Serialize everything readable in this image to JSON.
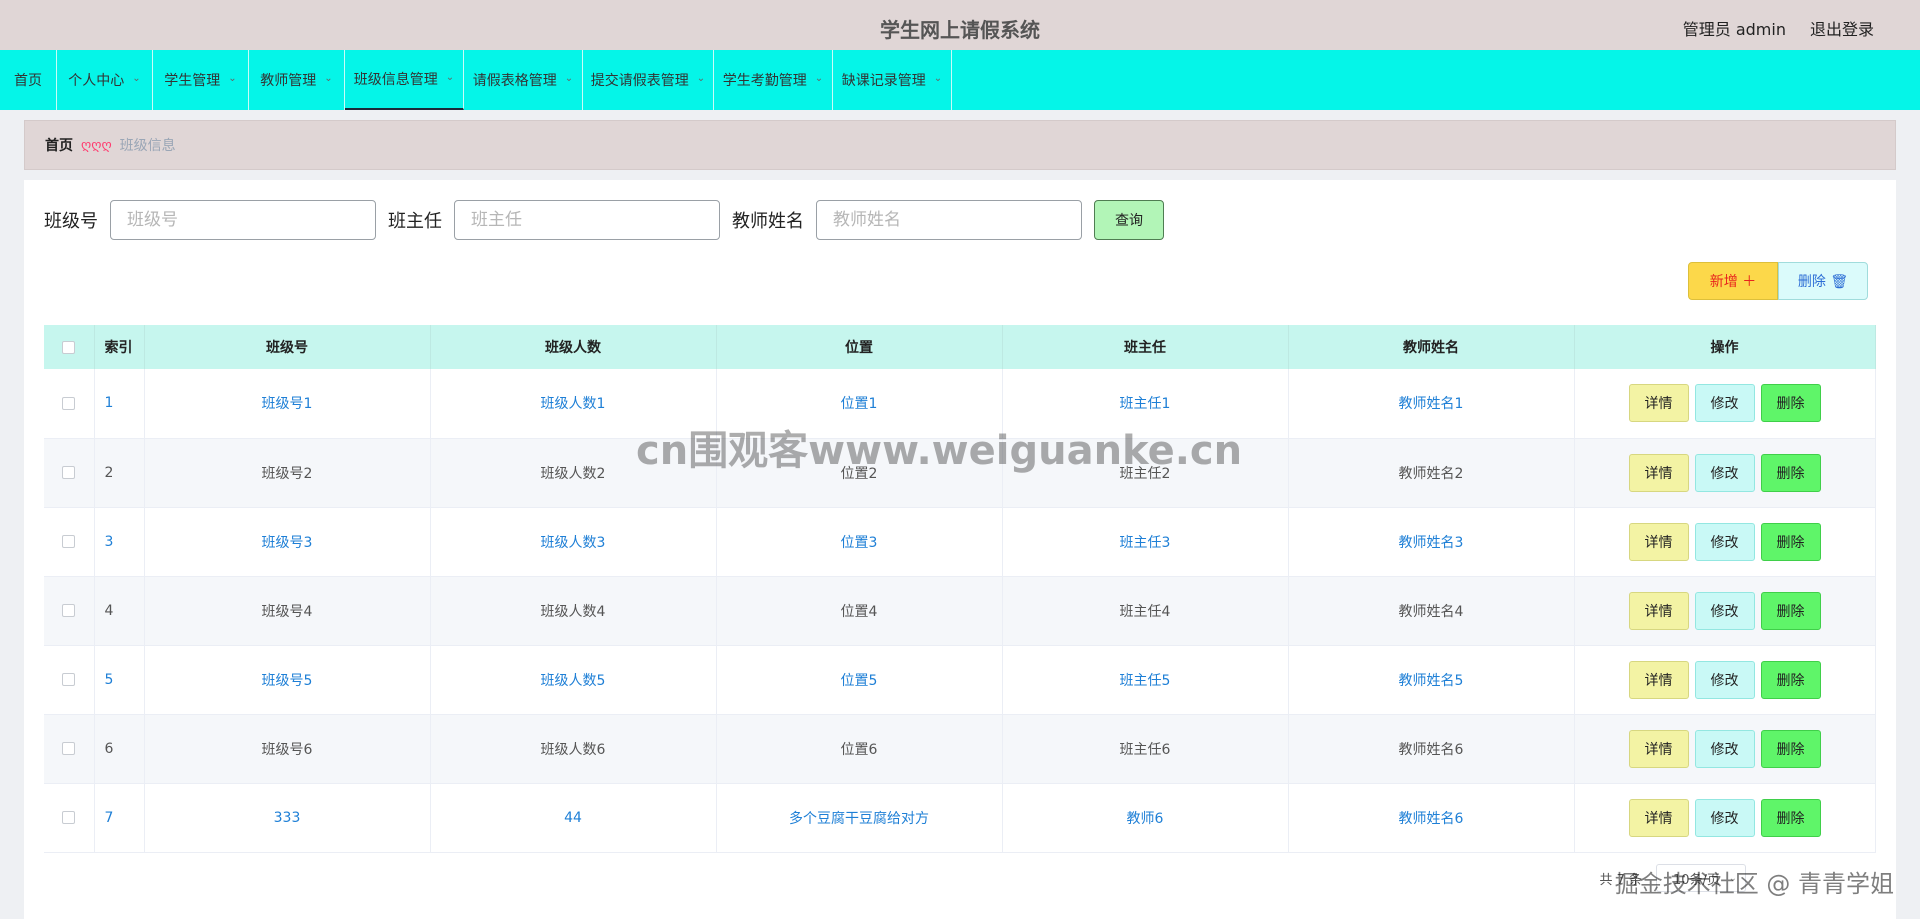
{
  "header": {
    "title": "学生网上请假系统",
    "user_label": "管理员 admin",
    "logout_label": "退出登录"
  },
  "nav": {
    "items": [
      {
        "label": "首页",
        "dropdown": false,
        "active": false
      },
      {
        "label": "个人中心",
        "dropdown": true,
        "active": false
      },
      {
        "label": "学生管理",
        "dropdown": true,
        "active": false
      },
      {
        "label": "教师管理",
        "dropdown": true,
        "active": false
      },
      {
        "label": "班级信息管理",
        "dropdown": true,
        "active": true
      },
      {
        "label": "请假表格管理",
        "dropdown": true,
        "active": false
      },
      {
        "label": "提交请假表管理",
        "dropdown": true,
        "active": false
      },
      {
        "label": "学生考勤管理",
        "dropdown": true,
        "active": false
      },
      {
        "label": "缺课记录管理",
        "dropdown": true,
        "active": false
      }
    ]
  },
  "breadcrumb": {
    "home": "首页",
    "separator": "ღღღ",
    "current": "班级信息"
  },
  "search": {
    "class_no_label": "班级号",
    "class_no_placeholder": "班级号",
    "head_teacher_label": "班主任",
    "head_teacher_placeholder": "班主任",
    "teacher_name_label": "教师姓名",
    "teacher_name_placeholder": "教师姓名",
    "query_label": "查询"
  },
  "actions": {
    "add_label": "新增 ＋",
    "delete_label": "删除 🗑"
  },
  "table": {
    "headers": {
      "index": "索引",
      "class_no": "班级号",
      "class_size": "班级人数",
      "location": "位置",
      "head_teacher": "班主任",
      "teacher_name": "教师姓名",
      "operation": "操作"
    },
    "buttons": {
      "detail": "详情",
      "edit": "修改",
      "delete": "删除"
    },
    "rows": [
      {
        "index": "1",
        "class_no": "班级号1",
        "class_size": "班级人数1",
        "location": "位置1",
        "head_teacher": "班主任1",
        "teacher_name": "教师姓名1"
      },
      {
        "index": "2",
        "class_no": "班级号2",
        "class_size": "班级人数2",
        "location": "位置2",
        "head_teacher": "班主任2",
        "teacher_name": "教师姓名2"
      },
      {
        "index": "3",
        "class_no": "班级号3",
        "class_size": "班级人数3",
        "location": "位置3",
        "head_teacher": "班主任3",
        "teacher_name": "教师姓名3"
      },
      {
        "index": "4",
        "class_no": "班级号4",
        "class_size": "班级人数4",
        "location": "位置4",
        "head_teacher": "班主任4",
        "teacher_name": "教师姓名4"
      },
      {
        "index": "5",
        "class_no": "班级号5",
        "class_size": "班级人数5",
        "location": "位置5",
        "head_teacher": "班主任5",
        "teacher_name": "教师姓名5"
      },
      {
        "index": "6",
        "class_no": "班级号6",
        "class_size": "班级人数6",
        "location": "位置6",
        "head_teacher": "班主任6",
        "teacher_name": "教师姓名6"
      },
      {
        "index": "7",
        "class_no": "333",
        "class_size": "44",
        "location": "多个豆腐干豆腐给对方",
        "head_teacher": "教师6",
        "teacher_name": "教师姓名6"
      }
    ]
  },
  "pager": {
    "total_label": "共 7 条",
    "page_size_label": "10条/页"
  },
  "watermarks": {
    "center": "cn围观客www.weiguanke.cn",
    "corner": "掘金技术社区 @ 青青学姐"
  }
}
